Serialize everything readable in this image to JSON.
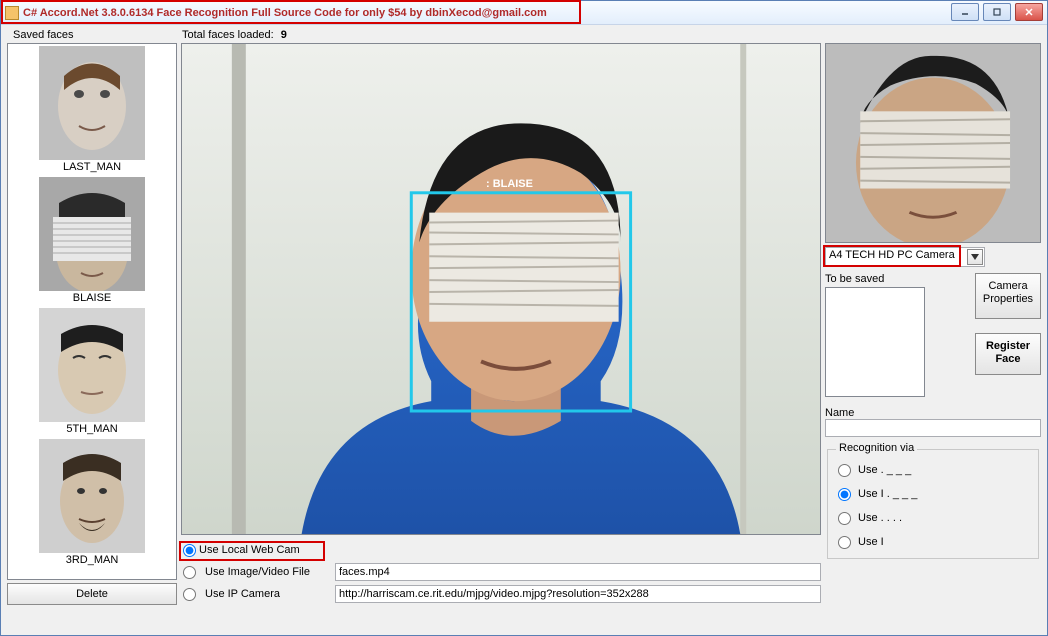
{
  "window": {
    "title": "C# Accord.Net 3.8.0.6134 Face Recognition Full Source Code for only $54 by dbinXecod@gmail.com"
  },
  "labels": {
    "saved_faces": "Saved faces",
    "total_faces": "Total faces loaded:",
    "total_faces_count": "9",
    "delete": "Delete",
    "to_be_saved": "To be saved",
    "name": "Name",
    "camera_props": "Camera Properties",
    "register_face": "Register Face"
  },
  "saved_faces": [
    {
      "label": "LAST_MAN"
    },
    {
      "label": "BLAISE"
    },
    {
      "label": "5TH_MAN"
    },
    {
      "label": "3RD_MAN"
    }
  ],
  "camera": {
    "selected": "A4 TECH HD PC Camera",
    "detected_name": "BLAISE"
  },
  "source": {
    "webcam_label": "Use Local Web Cam",
    "file_label": "Use Image/Video File",
    "file_value": "faces.mp4",
    "ip_label": "Use IP Camera",
    "ip_value": "http://harriscam.ce.rit.edu/mjpg/video.mjpg?resolution=352x288",
    "selected": "webcam"
  },
  "recognition": {
    "legend": "Recognition via",
    "options": [
      {
        "label": "Use .  _ _ _  ",
        "checked": false
      },
      {
        "label": "Use I . _ _ _  ",
        "checked": true
      },
      {
        "label": "Use . . . .",
        "checked": false
      },
      {
        "label": "Use I    ",
        "checked": false
      }
    ]
  }
}
